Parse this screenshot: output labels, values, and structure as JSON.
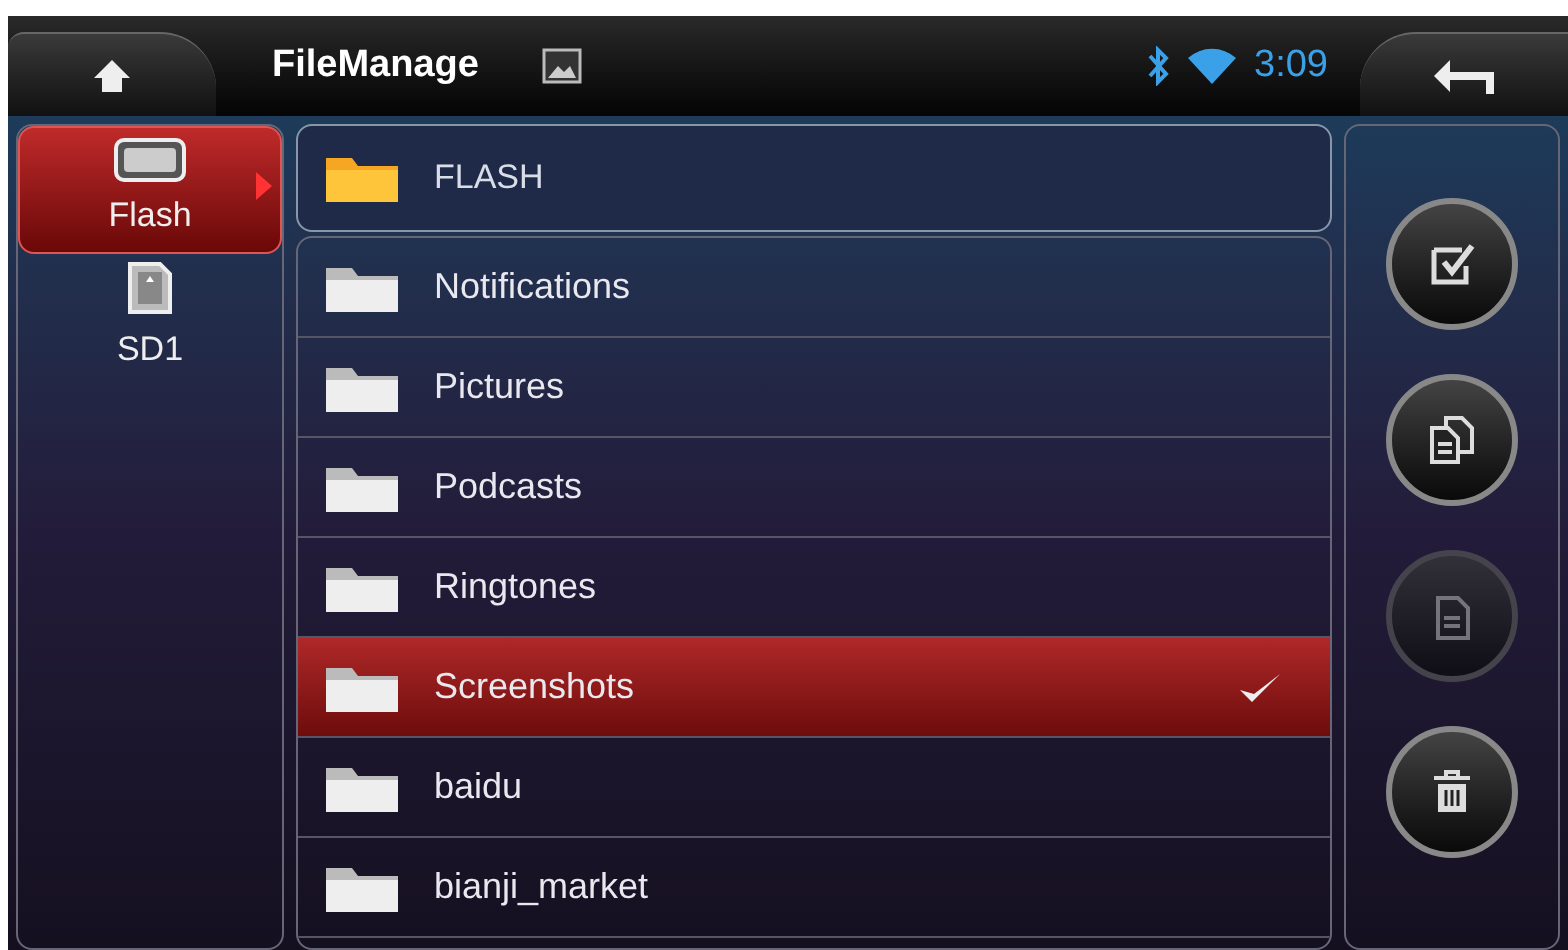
{
  "top_bar": {
    "title": "FileManage",
    "time": "3:09"
  },
  "sidebar": {
    "items": [
      {
        "label": "Flash",
        "kind": "flash",
        "selected": true
      },
      {
        "label": "SD1",
        "kind": "sd",
        "selected": false
      }
    ]
  },
  "path": {
    "label": "FLASH"
  },
  "files": [
    {
      "name": "Notifications",
      "selected": false
    },
    {
      "name": "Pictures",
      "selected": false
    },
    {
      "name": "Podcasts",
      "selected": false
    },
    {
      "name": "Ringtones",
      "selected": false
    },
    {
      "name": "Screenshots",
      "selected": true
    },
    {
      "name": "baidu",
      "selected": false
    },
    {
      "name": "bianji_market",
      "selected": false
    }
  ],
  "actions": [
    {
      "kind": "select",
      "disabled": false
    },
    {
      "kind": "copy",
      "disabled": false
    },
    {
      "kind": "paste",
      "disabled": true
    },
    {
      "kind": "delete",
      "disabled": false
    }
  ]
}
